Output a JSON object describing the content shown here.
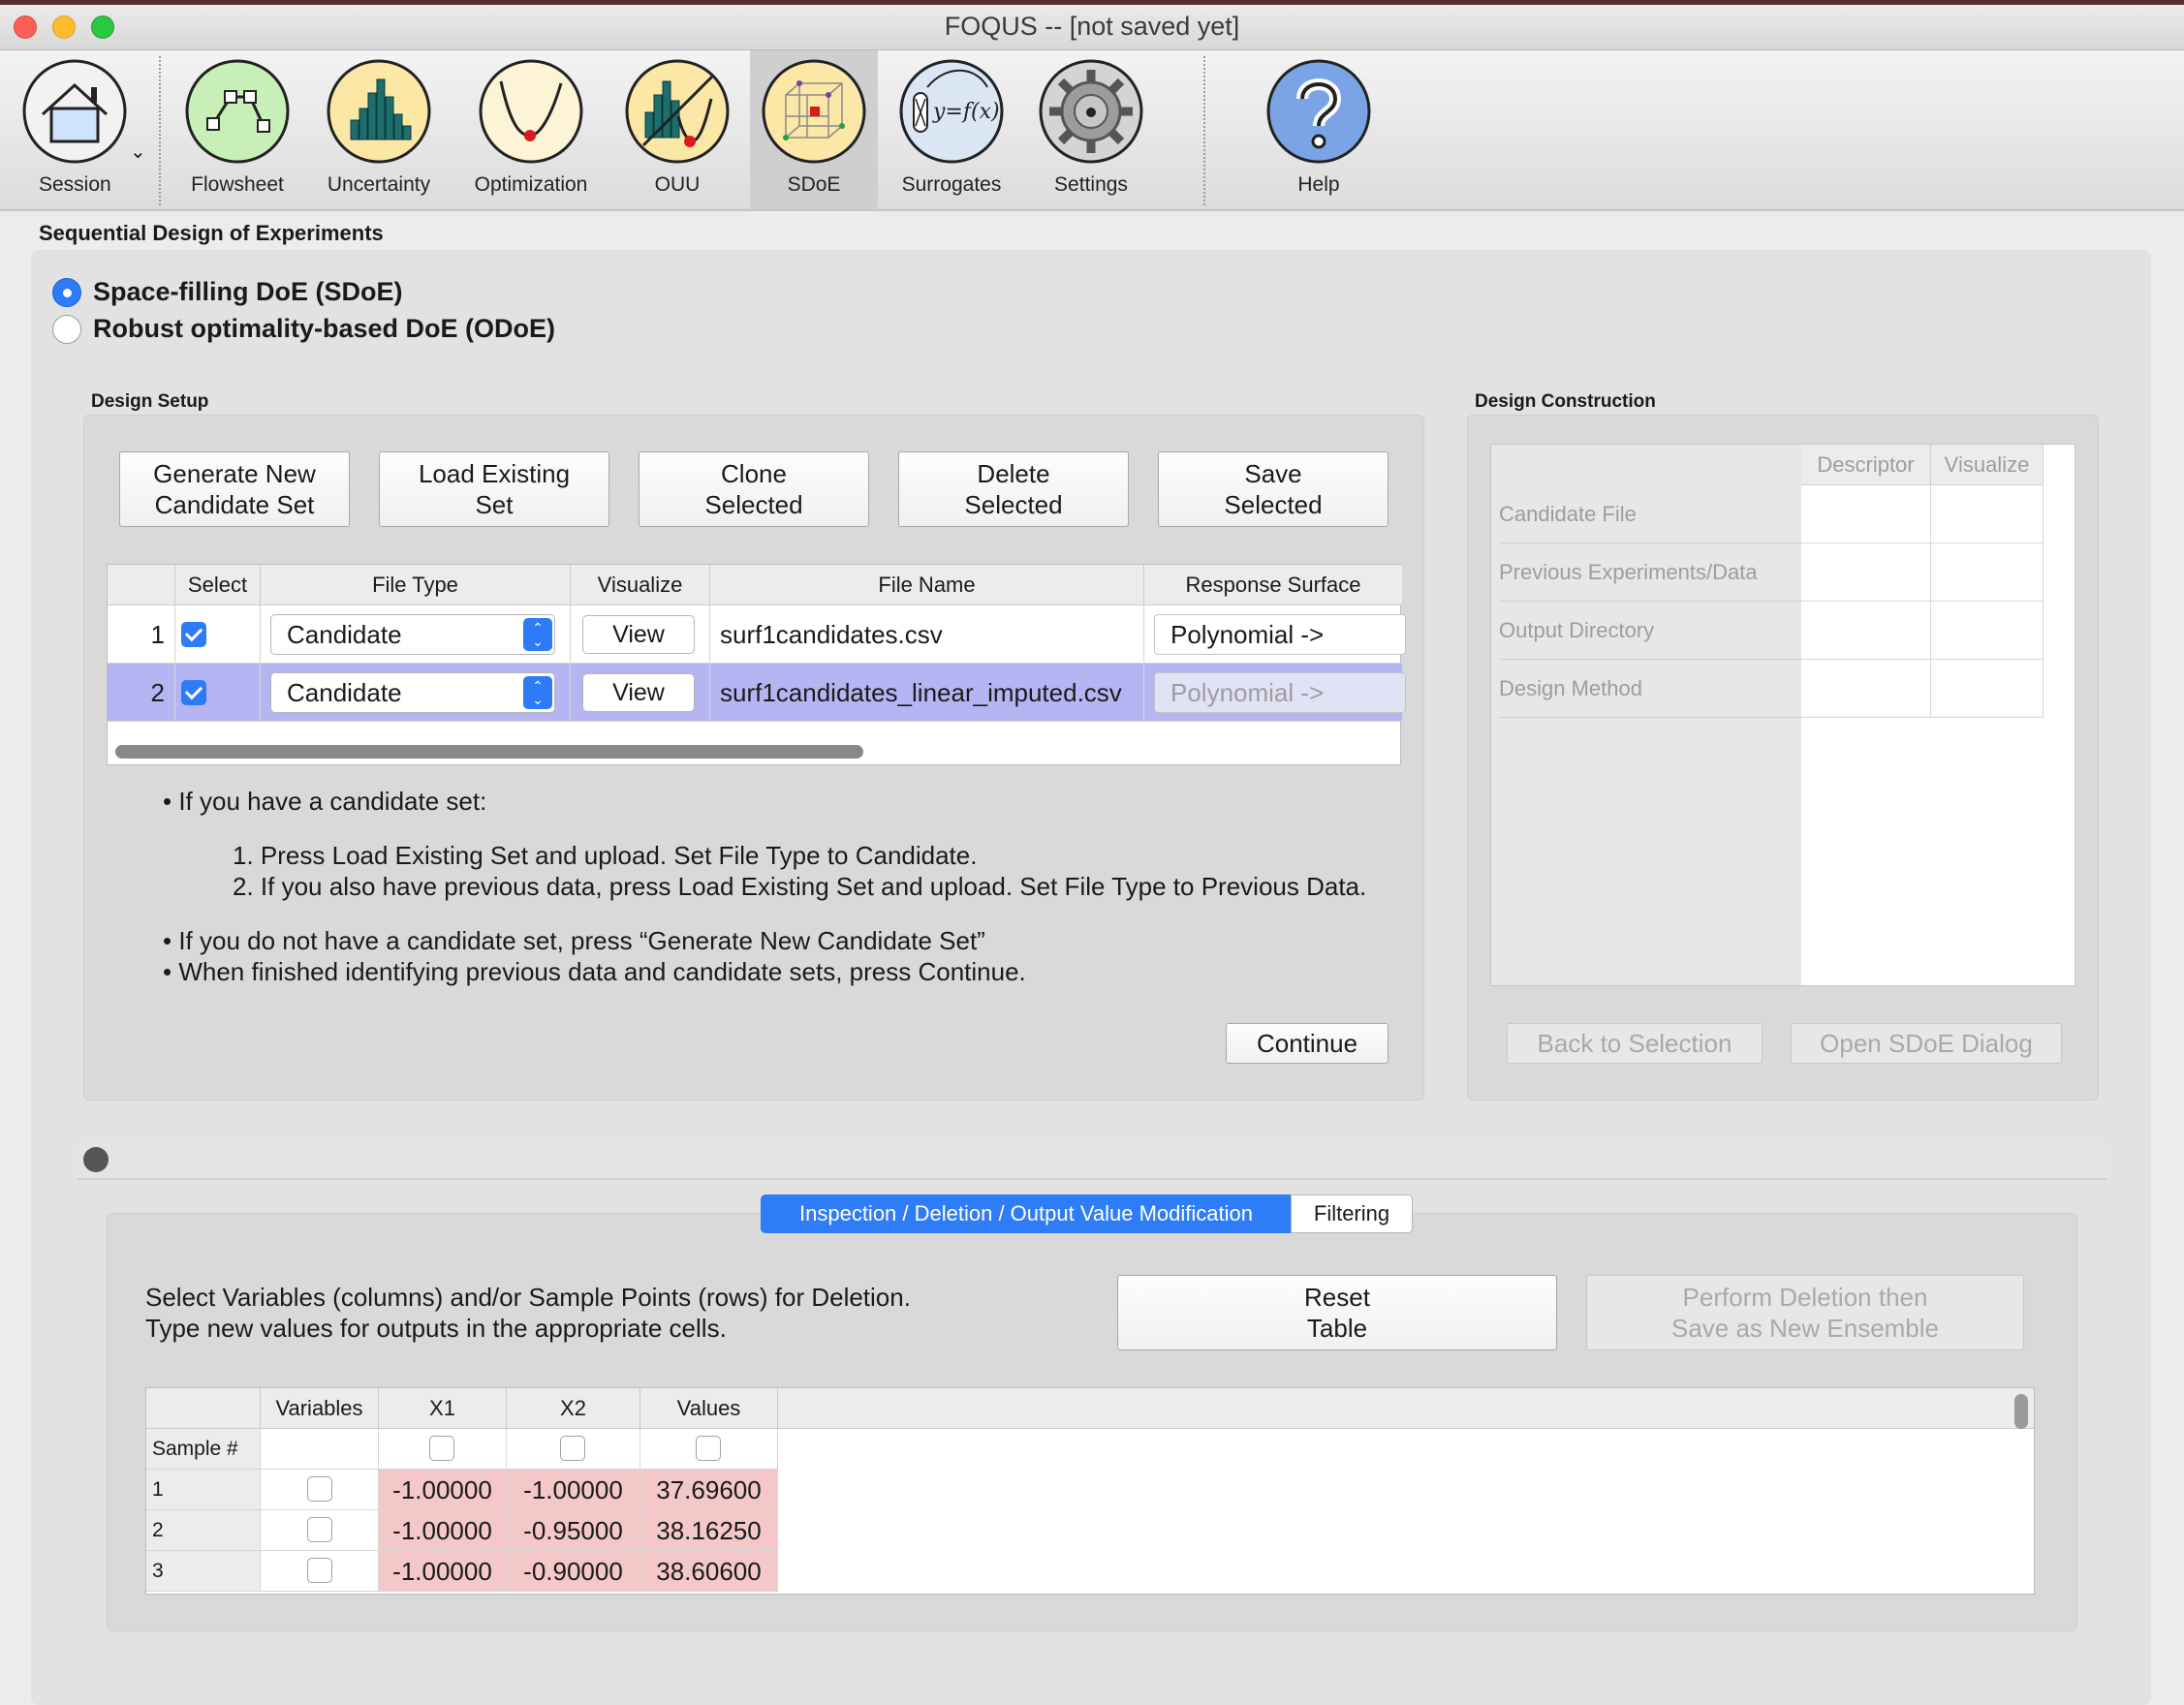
{
  "window": {
    "title": "FOQUS -- [not saved yet]"
  },
  "toolbar": {
    "items": [
      {
        "label": "Session",
        "icon": "house-icon"
      },
      {
        "label": "Flowsheet",
        "icon": "flowsheet-graph-icon"
      },
      {
        "label": "Uncertainty",
        "icon": "histogram-icon"
      },
      {
        "label": "Optimization",
        "icon": "optimization-curve-icon"
      },
      {
        "label": "OUU",
        "icon": "ouu-icon"
      },
      {
        "label": "SDoE",
        "icon": "sdoe-cube-icon",
        "active": true
      },
      {
        "label": "Surrogates",
        "icon": "surrogate-function-icon"
      },
      {
        "label": "Settings",
        "icon": "gear-icon"
      },
      {
        "label": "Help",
        "icon": "help-question-icon"
      }
    ],
    "surrogate_icon_text": "y=f(x)"
  },
  "page": {
    "title": "Sequential Design of Experiments",
    "radio_sdoe": "Space-filling DoE (SDoE)",
    "radio_odoe": "Robust optimality-based DoE (ODoE)"
  },
  "design_setup": {
    "label": "Design Setup",
    "buttons": {
      "generate": "Generate New\nCandidate Set",
      "load": "Load Existing\nSet",
      "clone": "Clone\nSelected",
      "delete": "Delete\nSelected",
      "save": "Save\nSelected"
    },
    "table": {
      "headers": [
        "Select",
        "File Type",
        "Visualize",
        "File Name",
        "Response Surface"
      ],
      "rows": [
        {
          "num": "1",
          "file_type": "Candidate",
          "visualize": "View",
          "file_name": "surf1candidates.csv",
          "response": "Polynomial ->"
        },
        {
          "num": "2",
          "file_type": "Candidate",
          "visualize": "View",
          "file_name": "surf1candidates_linear_imputed.csv",
          "response": "Polynomial ->"
        }
      ]
    },
    "instructions": {
      "b1": "If you have a candidate set:",
      "n1": "Press Load Existing Set and upload. Set File Type to Candidate.",
      "n2": "If you also have previous data, press Load Existing Set and upload. Set File Type to Previous Data.",
      "b2": "If you do not have a candidate set, press “Generate New Candidate Set”",
      "b3": "When finished identifying previous data and candidate sets, press Continue."
    },
    "continue": "Continue"
  },
  "design_construction": {
    "label": "Design Construction",
    "headers": [
      "Descriptor",
      "Visualize"
    ],
    "rows": [
      "Candidate File",
      "Previous Experiments/Data",
      "Output Directory",
      "Design Method"
    ],
    "back": "Back to Selection",
    "open": "Open SDoE Dialog"
  },
  "lower": {
    "tab_active": "Inspection / Deletion / Output Value Modification",
    "tab_filter": "Filtering",
    "instr1": "Select Variables (columns) and/or Sample Points (rows) for Deletion.",
    "instr2": "Type new values for outputs in the appropriate cells.",
    "reset": "Reset\nTable",
    "perform": "Perform Deletion then\nSave as New Ensemble",
    "table": {
      "headers": [
        "Variables",
        "X1",
        "X2",
        "Values"
      ],
      "sample_label": "Sample #",
      "rows": [
        {
          "num": "1",
          "x1": "-1.00000",
          "x2": "-1.00000",
          "val": "37.69600"
        },
        {
          "num": "2",
          "x1": "-1.00000",
          "x2": "-0.95000",
          "val": "38.16250"
        },
        {
          "num": "3",
          "x1": "-1.00000",
          "x2": "-0.90000",
          "val": "38.60600"
        }
      ]
    }
  },
  "colors": {
    "accent": "#2d7bf6",
    "selected_row": "#b6b5f3",
    "value_cell": "#f4c8c8"
  }
}
